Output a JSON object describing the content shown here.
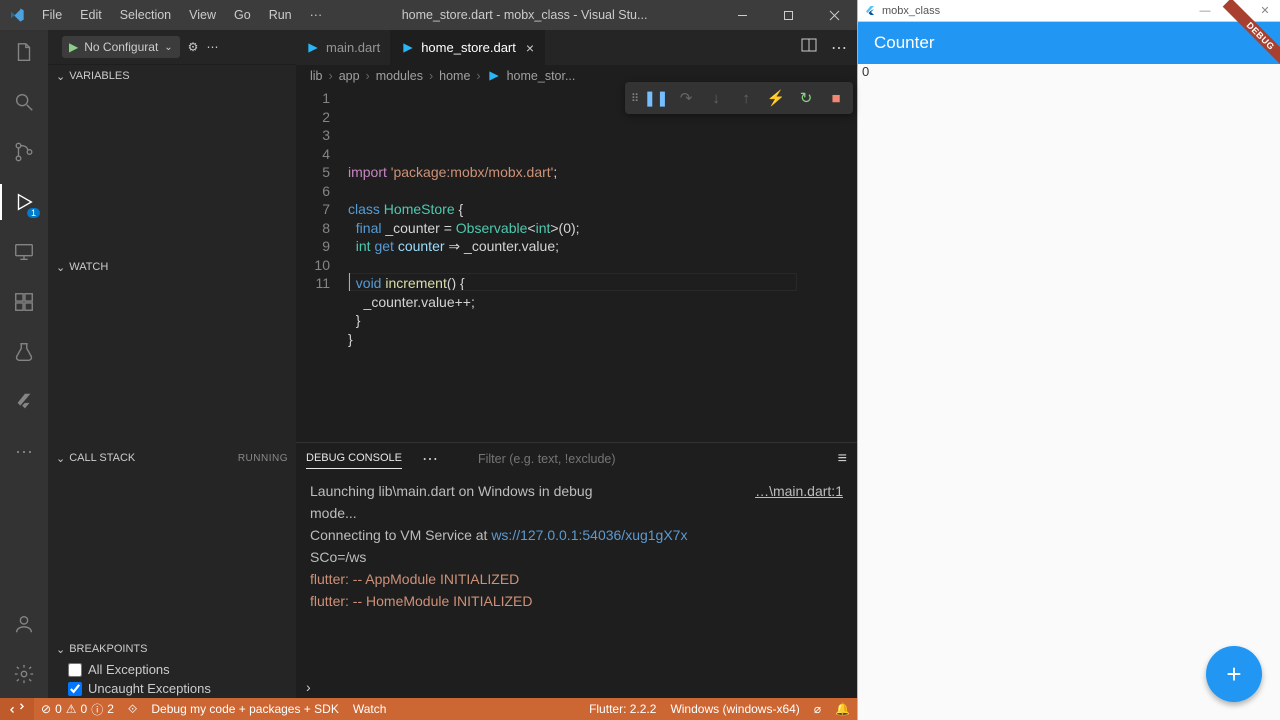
{
  "title": "home_store.dart - mobx_class - Visual Stu...",
  "menu": [
    "File",
    "Edit",
    "Selection",
    "View",
    "Go",
    "Run",
    "···"
  ],
  "run_config": "No Configurat",
  "activity_badge": "1",
  "sidebar": {
    "variables": "VARIABLES",
    "watch": "WATCH",
    "callstack": "CALL STACK",
    "running": "RUNNING",
    "breakpoints": "BREAKPOINTS",
    "bp_all": "All Exceptions",
    "bp_uncaught": "Uncaught Exceptions"
  },
  "tabs": {
    "main": "main.dart",
    "home": "home_store.dart"
  },
  "breadcrumb": [
    "lib",
    "app",
    "modules",
    "home",
    "home_stor..."
  ],
  "code_lines": [
    {
      "n": "1",
      "html": "<span class='kw2'>import</span> <span class='str'>'package:mobx/mobx.dart'</span>;"
    },
    {
      "n": "2",
      "html": ""
    },
    {
      "n": "3",
      "html": "<span class='kw'>class</span> <span class='type'>HomeStore</span> {"
    },
    {
      "n": "4",
      "html": "  <span class='kw'>final</span> _counter = <span class='type'>Observable</span>&lt;<span class='type'>int</span>&gt;(0);"
    },
    {
      "n": "5",
      "html": "  <span class='type'>int</span> <span class='kw'>get</span> <span class='var'>counter</span> ⇒ _counter.value;"
    },
    {
      "n": "6",
      "html": ""
    },
    {
      "n": "7",
      "html": "  <span class='kw'>void</span> <span class='fn'>increment</span>() {"
    },
    {
      "n": "8",
      "html": "    _counter.value++;"
    },
    {
      "n": "9",
      "html": "  }"
    },
    {
      "n": "10",
      "html": "}"
    },
    {
      "n": "11",
      "html": ""
    }
  ],
  "panel": {
    "tab": "DEBUG CONSOLE",
    "filter_placeholder": "Filter (e.g. text, !exclude)",
    "link": "…\\main.dart:1",
    "lines": [
      "Launching lib\\main.dart on Windows in debug",
      "mode...",
      "Connecting to VM Service at ws://127.0.0.1:54036/xug1gX7x",
      "SCo=/ws",
      "flutter: -- AppModule INITIALIZED",
      "flutter: -- HomeModule INITIALIZED"
    ]
  },
  "status": {
    "errors": "0",
    "warnings": "0",
    "info": "2",
    "debug_cfg": "Debug my code + packages + SDK",
    "watch": "Watch",
    "flutter": "Flutter: 2.2.2",
    "platform": "Windows (windows-x64)"
  },
  "flutter_app": {
    "window_title": "mobx_class",
    "appbar_title": "Counter",
    "debug_banner": "DEBUG",
    "counter_value": "0"
  }
}
